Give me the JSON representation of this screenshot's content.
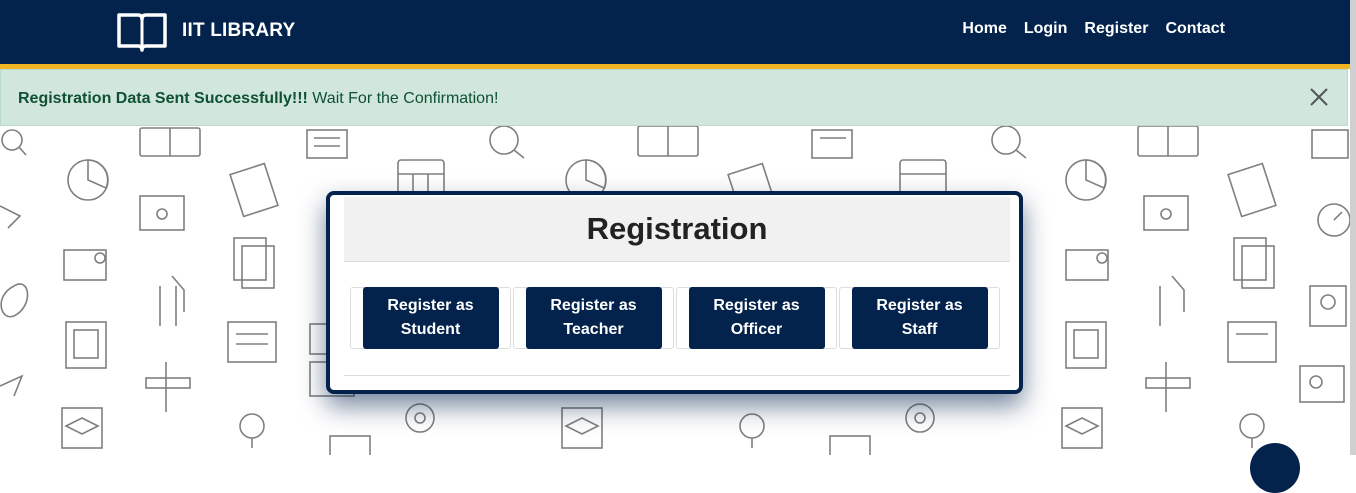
{
  "navbar": {
    "brand": "IIT LIBRARY",
    "links": [
      "Home",
      "Login",
      "Register",
      "Contact"
    ]
  },
  "alert": {
    "strong": "Registration Data Sent Successfully!!!",
    "message": " Wait For the Confirmation!"
  },
  "registration": {
    "title": "Registration",
    "buttons": [
      "Register as Student",
      "Register as Teacher",
      "Register as Officer",
      "Register as Staff"
    ]
  },
  "colors": {
    "navy": "#03224c",
    "gold": "#f0b521",
    "alert_bg": "#d1e7dd",
    "alert_text": "#0f5132"
  },
  "icons": [
    "book-icon",
    "close-icon",
    "doodle-pattern"
  ]
}
